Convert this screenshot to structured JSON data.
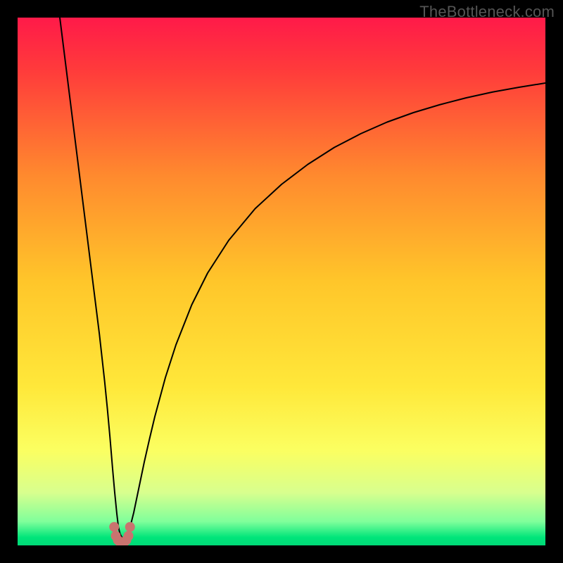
{
  "watermark": "TheBottleneck.com",
  "chart_data": {
    "type": "line",
    "title": "",
    "xlabel": "",
    "ylabel": "",
    "xlim": [
      0,
      100
    ],
    "ylim": [
      0,
      100
    ],
    "background_gradient": {
      "stops": [
        {
          "pos": 0.0,
          "color": "#ff1a49"
        },
        {
          "pos": 0.1,
          "color": "#ff3b3b"
        },
        {
          "pos": 0.3,
          "color": "#ff8a2e"
        },
        {
          "pos": 0.5,
          "color": "#ffc62a"
        },
        {
          "pos": 0.7,
          "color": "#ffe83a"
        },
        {
          "pos": 0.82,
          "color": "#fbff61"
        },
        {
          "pos": 0.9,
          "color": "#d8ff8e"
        },
        {
          "pos": 0.955,
          "color": "#7fff9b"
        },
        {
          "pos": 0.985,
          "color": "#00e57a"
        },
        {
          "pos": 1.0,
          "color": "#00d977"
        }
      ]
    },
    "series": [
      {
        "name": "bottleneck-curve",
        "color": "#000000",
        "width": 2.0,
        "x": [
          8.0,
          9.0,
          10.0,
          11.0,
          12.0,
          13.0,
          14.0,
          15.0,
          15.5,
          16.0,
          16.5,
          17.0,
          17.5,
          18.0,
          18.4,
          18.8,
          19.1,
          19.4,
          19.7,
          20.0,
          20.5,
          21.0,
          21.5,
          22.0,
          23.0,
          24.0,
          25.0,
          26.0,
          28.0,
          30.0,
          33.0,
          36.0,
          40.0,
          45.0,
          50.0,
          55.0,
          60.0,
          65.0,
          70.0,
          75.0,
          80.0,
          85.0,
          90.0,
          95.0,
          100.0
        ],
        "y": [
          100.0,
          92.0,
          84.0,
          76.0,
          68.0,
          60.0,
          52.0,
          44.0,
          40.0,
          35.5,
          31.0,
          26.0,
          20.5,
          14.5,
          10.0,
          6.0,
          3.5,
          2.2,
          1.6,
          1.4,
          1.7,
          2.6,
          4.2,
          6.2,
          11.0,
          15.8,
          20.2,
          24.4,
          31.8,
          38.0,
          45.6,
          51.6,
          57.8,
          63.8,
          68.4,
          72.2,
          75.4,
          78.0,
          80.2,
          82.0,
          83.5,
          84.8,
          85.9,
          86.8,
          87.6
        ]
      }
    ],
    "markers": {
      "name": "bottleneck-min-markers",
      "color": "#c9736f",
      "radius": 7,
      "points": [
        {
          "x": 18.3,
          "y": 3.5
        },
        {
          "x": 18.6,
          "y": 1.8
        },
        {
          "x": 19.0,
          "y": 1.0
        },
        {
          "x": 19.4,
          "y": 0.6
        },
        {
          "x": 19.8,
          "y": 0.4
        },
        {
          "x": 20.2,
          "y": 0.6
        },
        {
          "x": 20.6,
          "y": 1.0
        },
        {
          "x": 21.0,
          "y": 1.8
        },
        {
          "x": 21.3,
          "y": 3.5
        }
      ]
    }
  }
}
